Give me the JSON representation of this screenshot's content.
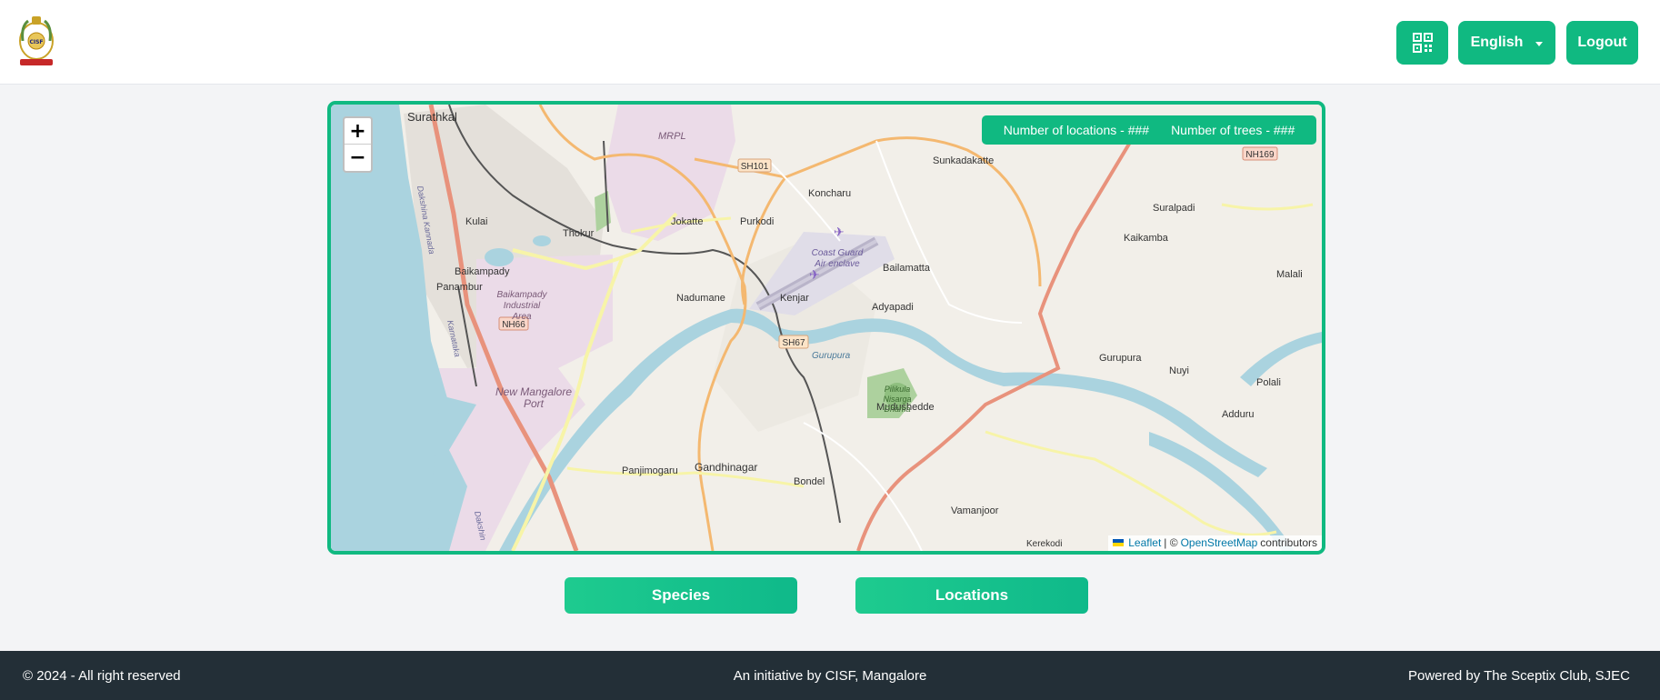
{
  "header": {
    "logo_alt": "CISF emblem",
    "language": "English",
    "logout_label": "Logout",
    "qr_icon": "qr-code-icon"
  },
  "map": {
    "zoom_in": "+",
    "zoom_out": "−",
    "stats": {
      "locations": "Number of locations - ###",
      "trees": "Number of trees - ###"
    },
    "attribution": {
      "leaflet": "Leaflet",
      "separator": "| ©",
      "osm": "OpenStreetMap",
      "suffix": "contributors"
    },
    "labels": {
      "surathkal": "Surathkal",
      "mrpl": "MRPL",
      "sh101": "SH101",
      "koncharu": "Koncharu",
      "sunkadakatte": "Sunkadakatte",
      "nh169": "NH169",
      "suralpadi": "Suralpadi",
      "kulai": "Kulai",
      "thokur": "Thokur",
      "jokatte": "Jokatte",
      "purkodi": "Purkodi",
      "kaikamba": "Kaikamba",
      "coast_guard_1": "Coast Guard",
      "coast_guard_2": "Air enclave",
      "bailamatta": "Bailamatta",
      "malali": "Malali",
      "baikampady": "Baikampady",
      "panambur": "Panambur",
      "industrial_1": "Baikampady",
      "industrial_2": "Industrial",
      "industrial_3": "Area",
      "nadumane": "Nadumane",
      "kenjar": "Kenjar",
      "adyapadi": "Adyapadi",
      "nh66": "NH66",
      "sh67": "SH67",
      "gurupura_river": "Gurupura",
      "gurupura": "Gurupura",
      "nuyi": "Nuyi",
      "polali": "Polali",
      "adduru": "Adduru",
      "port_1": "New Mangalore",
      "port_2": "Port",
      "mudushedde": "Mudushedde",
      "pilikula_1": "Pilikula",
      "pilikula_2": "Nisarga",
      "pilikula_3": "Dhama",
      "panjimogaru": "Panjimogaru",
      "gandhinagar": "Gandhinagar",
      "bondel": "Bondel",
      "vamanjoor": "Vamanjoor",
      "kerekodi": "Kerekodi",
      "dakshina_kannada_1": "Dakshina Kannada",
      "karnataka": "Karnataka",
      "dakshina_2": "Dakshin"
    }
  },
  "actions": {
    "species_label": "Species",
    "locations_label": "Locations"
  },
  "footer": {
    "left": "© 2024 - All right reserved",
    "center": "An initiative by CISF, Mangalore",
    "right": "Powered by The Sceptix Club, SJEC"
  },
  "colors": {
    "accent": "#10b981",
    "footer_bg": "#232f37",
    "water": "#aad3df"
  }
}
